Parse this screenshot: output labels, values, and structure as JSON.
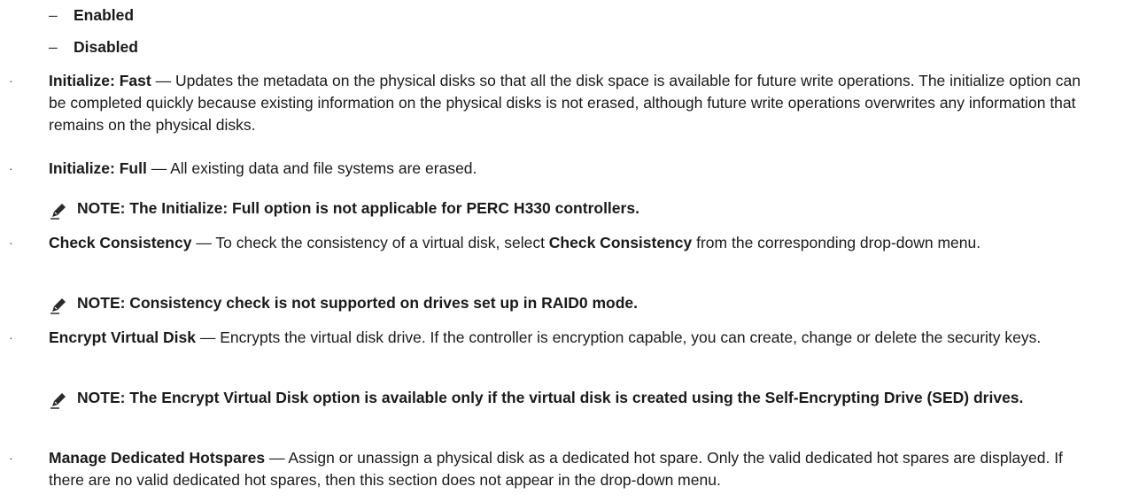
{
  "sub_items": [
    {
      "dash": "–",
      "label": "Enabled"
    },
    {
      "dash": "–",
      "label": "Disabled"
    }
  ],
  "bullets": [
    {
      "marker": "·",
      "term": "Initialize: Fast",
      "sep": " — ",
      "text": "Updates the metadata on the physical disks so that all the disk space is available for future write operations. The initialize option can be completed quickly because existing information on the physical disks is not erased, although future write operations overwrites any information that remains on the physical disks."
    },
    {
      "marker": "·",
      "term": "Initialize: Full",
      "sep": " — ",
      "text": "All existing data and file systems are erased."
    },
    {
      "marker": "·",
      "term": "Check Consistency",
      "sep": " — ",
      "text_before": "To check the consistency of a virtual disk, select ",
      "inline_bold": "Check Consistency",
      "text_after": " from the corresponding drop-down menu."
    },
    {
      "marker": "·",
      "term": "Encrypt Virtual Disk",
      "sep": " — ",
      "text": "Encrypts the virtual disk drive. If the controller is encryption capable, you can create, change or delete the security keys."
    },
    {
      "marker": "·",
      "term": "Manage Dedicated Hotspares",
      "sep": " — ",
      "text": "Assign or unassign a physical disk as a dedicated hot spare. Only the valid dedicated hot spares are displayed. If there are no valid dedicated hot spares, then this section does not appear in the drop-down menu."
    }
  ],
  "notes": [
    {
      "icon": "pencil-note-icon",
      "text": "NOTE: The Initialize: Full option is not applicable for PERC H330 controllers."
    },
    {
      "icon": "pencil-note-icon",
      "text": "NOTE: Consistency check is not supported on drives set up in RAID0 mode."
    },
    {
      "icon": "pencil-note-icon",
      "text": "NOTE: The Encrypt Virtual Disk option is available only if the virtual disk is created using the Self-Encrypting Drive (SED) drives."
    }
  ]
}
